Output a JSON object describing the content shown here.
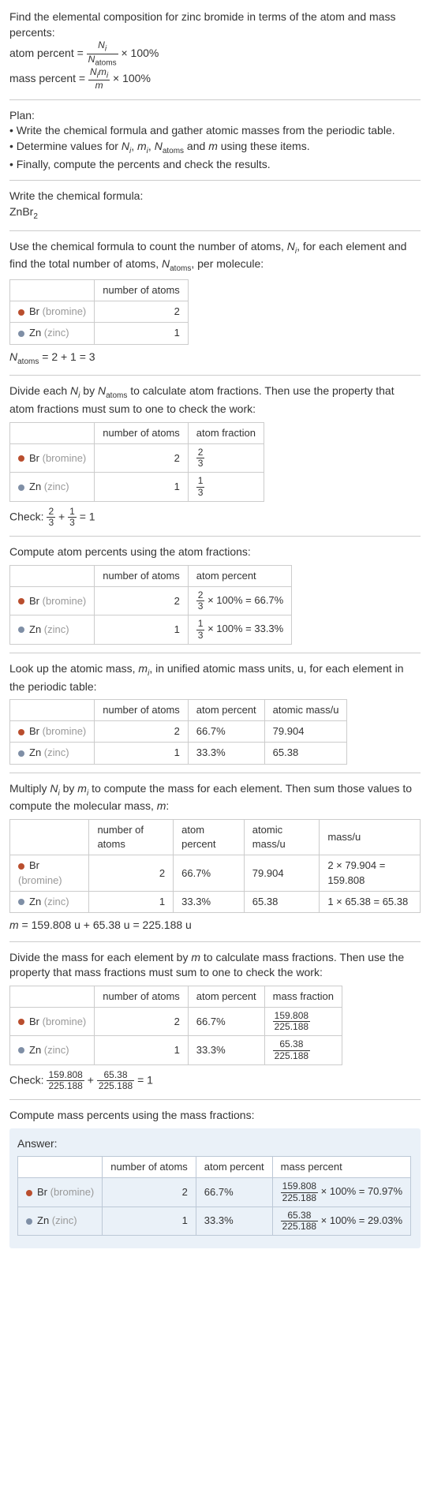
{
  "intro": {
    "line1": "Find the elemental composition for zinc bromide in terms of the atom and mass percents:",
    "atom_percent_label": "atom percent = ",
    "mass_percent_label": "mass percent = ",
    "frac_atom_num": "N",
    "frac_atom_num_sub": "i",
    "frac_atom_den": "N",
    "frac_atom_den_sub": "atoms",
    "frac_mass_num": "N",
    "frac_mass_num_sub": "i",
    "frac_mass_num2": "m",
    "frac_mass_num2_sub": "i",
    "frac_mass_den": "m",
    "times100": " × 100%"
  },
  "plan": {
    "title": "Plan:",
    "b1": "• Write the chemical formula and gather atomic masses from the periodic table.",
    "b2_a": "• Determine values for ",
    "b2_b": " using these items.",
    "b3": "• Finally, compute the percents and check the results."
  },
  "formula_section": {
    "title": "Write the chemical formula:",
    "formula": "ZnBr",
    "formula_sub": "2"
  },
  "count_section": {
    "intro_a": "Use the chemical formula to count the number of atoms, ",
    "intro_b": ", for each element and find the total number of atoms, ",
    "intro_c": ", per molecule:",
    "header_num": "number of atoms",
    "br_label": "Br",
    "br_paren": "(bromine)",
    "zn_label": "Zn",
    "zn_paren": "(zinc)",
    "br_count": "2",
    "zn_count": "1",
    "sum_line": " = 2 + 1 = 3"
  },
  "atomfrac_section": {
    "intro": "Divide each ",
    "intro2": " by ",
    "intro3": " to calculate atom fractions. Then use the property that atom fractions must sum to one to check the work:",
    "header_num": "number of atoms",
    "header_frac": "atom fraction",
    "br_count": "2",
    "zn_count": "1",
    "br_frac_num": "2",
    "br_frac_den": "3",
    "zn_frac_num": "1",
    "zn_frac_den": "3",
    "check_label": "Check: ",
    "check_eq": " = 1"
  },
  "atompct_section": {
    "intro": "Compute atom percents using the atom fractions:",
    "header_num": "number of atoms",
    "header_pct": "atom percent",
    "br_count": "2",
    "zn_count": "1",
    "br_pct_suffix": " × 100% = 66.7%",
    "zn_pct_suffix": " × 100% = 33.3%"
  },
  "mass_lookup": {
    "intro_a": "Look up the atomic mass, ",
    "intro_b": ", in unified atomic mass units, u, for each element in the periodic table:",
    "header_num": "number of atoms",
    "header_pct": "atom percent",
    "header_mass": "atomic mass/u",
    "br_count": "2",
    "zn_count": "1",
    "br_pct": "66.7%",
    "zn_pct": "33.3%",
    "br_mass": "79.904",
    "zn_mass": "65.38"
  },
  "mass_calc": {
    "intro_a": "Multiply ",
    "intro_b": " by ",
    "intro_c": " to compute the mass for each element. Then sum those values to compute the molecular mass, ",
    "intro_d": ":",
    "header_num": "number of atoms",
    "header_pct": "atom percent",
    "header_mass": "atomic mass/u",
    "header_massu": "mass/u",
    "br_count": "2",
    "zn_count": "1",
    "br_pct": "66.7%",
    "zn_pct": "33.3%",
    "br_mass": "79.904",
    "zn_mass": "65.38",
    "br_massu": "2 × 79.904 = 159.808",
    "zn_massu": "1 × 65.38 = 65.38",
    "mline": " = 159.808 u + 65.38 u = 225.188 u"
  },
  "massfrac_section": {
    "intro": "Divide the mass for each element by ",
    "intro2": " to calculate mass fractions. Then use the property that mass fractions must sum to one to check the work:",
    "header_num": "number of atoms",
    "header_pct": "atom percent",
    "header_mfrac": "mass fraction",
    "br_count": "2",
    "zn_count": "1",
    "br_pct": "66.7%",
    "zn_pct": "33.3%",
    "br_mfrac_num": "159.808",
    "br_mfrac_den": "225.188",
    "zn_mfrac_num": "65.38",
    "zn_mfrac_den": "225.188",
    "check_label": "Check: ",
    "check_eq": " = 1"
  },
  "final_section": {
    "intro": "Compute mass percents using the mass fractions:",
    "answer_label": "Answer:",
    "header_num": "number of atoms",
    "header_pct": "atom percent",
    "header_mpct": "mass percent",
    "br_count": "2",
    "zn_count": "1",
    "br_pct": "66.7%",
    "zn_pct": "33.3%",
    "br_mfrac_num": "159.808",
    "br_mfrac_den": "225.188",
    "zn_mfrac_num": "65.38",
    "zn_mfrac_den": "225.188",
    "br_mpct_suffix": " × 100% = 70.97%",
    "zn_mpct_suffix": " × 100% = 29.03%"
  },
  "common": {
    "Ni": "N",
    "i_sub": "i",
    "Natoms": "N",
    "atoms_sub": "atoms",
    "mi": "m",
    "m": "m",
    "and": " and "
  }
}
